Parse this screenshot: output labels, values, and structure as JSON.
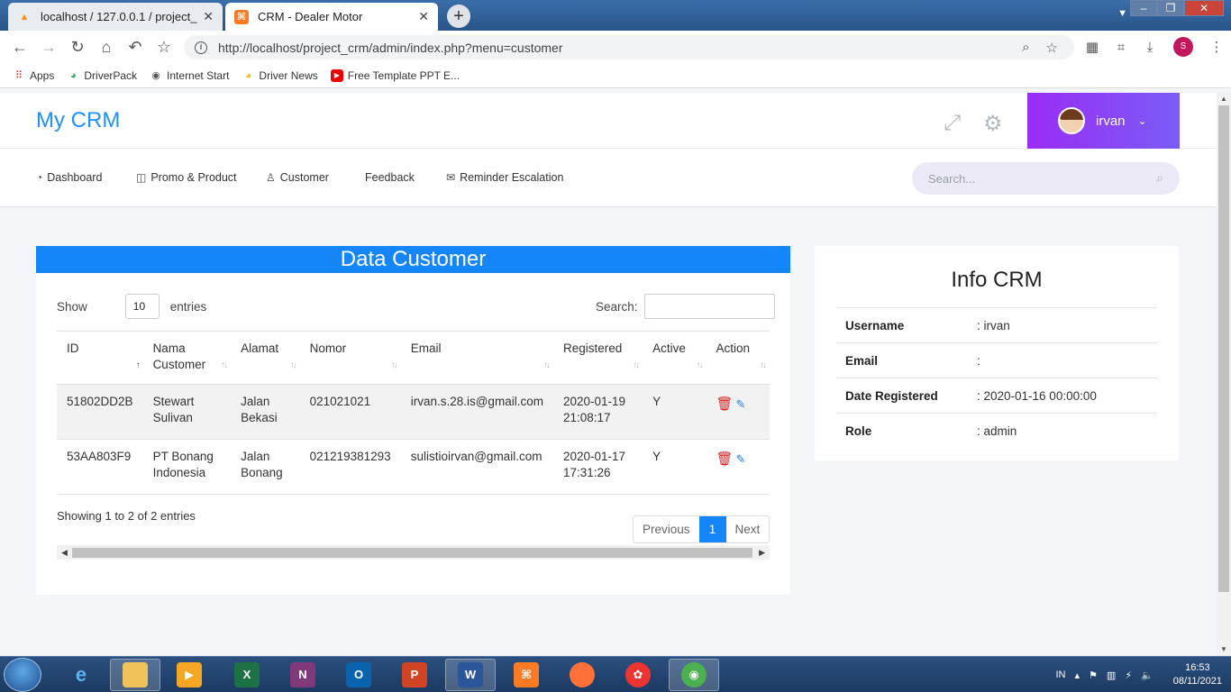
{
  "browser": {
    "tabs": [
      {
        "label": "localhost / 127.0.0.1 / project_crm",
        "close": "✕"
      },
      {
        "label": "CRM - Dealer Motor",
        "close": "✕"
      }
    ],
    "new_tab": "+",
    "url": "http://localhost/project_crm/admin/index.php?menu=customer",
    "profile_initial": "S",
    "bookmarks": [
      {
        "label": "Apps",
        "icon": "apps-grid-icon"
      },
      {
        "label": "DriverPack",
        "icon": "driverpack-icon"
      },
      {
        "label": "Internet Start",
        "icon": "globe-icon"
      },
      {
        "label": "Driver News",
        "icon": "drivernews-icon"
      },
      {
        "label": "Free Template PPT E...",
        "icon": "youtube-icon"
      }
    ]
  },
  "header": {
    "brand": "My CRM",
    "user": "irvan"
  },
  "nav": {
    "items": [
      {
        "label": "Dashboard",
        "icon": "dashboard-icon"
      },
      {
        "label": "Promo & Product",
        "icon": "product-icon"
      },
      {
        "label": "Customer",
        "icon": "user-icon"
      },
      {
        "label": "Feedback",
        "icon": ""
      },
      {
        "label": "Reminder Escalation",
        "icon": "mail-icon"
      }
    ],
    "search_placeholder": "Search..."
  },
  "customers": {
    "title": "Data Customer",
    "show_label": "Show",
    "entries_value": "10",
    "entries_label": "entries",
    "search_label": "Search:",
    "columns": [
      "ID",
      "Nama Customer",
      "Alamat",
      "Nomor",
      "Email",
      "Registered",
      "Active",
      "Action"
    ],
    "rows": [
      {
        "id": "51802DD2B",
        "nama": "Stewart Sulivan",
        "alamat": "Jalan Bekasi",
        "nomor": "021021021",
        "email": "irvan.s.28.is@gmail.com",
        "registered": "2020-01-19 21:08:17",
        "active": "Y"
      },
      {
        "id": "53AA803F9",
        "nama": "PT Bonang Indonesia",
        "alamat": "Jalan Bonang",
        "nomor": "021219381293",
        "email": "sulistioirvan@gmail.com",
        "registered": "2020-01-17 17:31:26",
        "active": "Y"
      }
    ],
    "info": "Showing 1 to 2 of 2 entries",
    "pager": {
      "previous": "Previous",
      "current": "1",
      "next": "Next"
    }
  },
  "info_crm": {
    "title": "Info CRM",
    "rows": [
      {
        "key": "Username",
        "value": ": irvan"
      },
      {
        "key": "Email",
        "value": ":"
      },
      {
        "key": "Date Registered",
        "value": ": 2020-01-16 00:00:00"
      },
      {
        "key": "Role",
        "value": ": admin"
      }
    ]
  },
  "taskbar": {
    "language": "IN",
    "time": "16:53",
    "date": "08/11/2021"
  },
  "colors": {
    "accent": "#1585fa",
    "brand": "#1e90ff",
    "user_gradient_start": "#9a2cf5",
    "user_gradient_end": "#7b5cf7"
  }
}
